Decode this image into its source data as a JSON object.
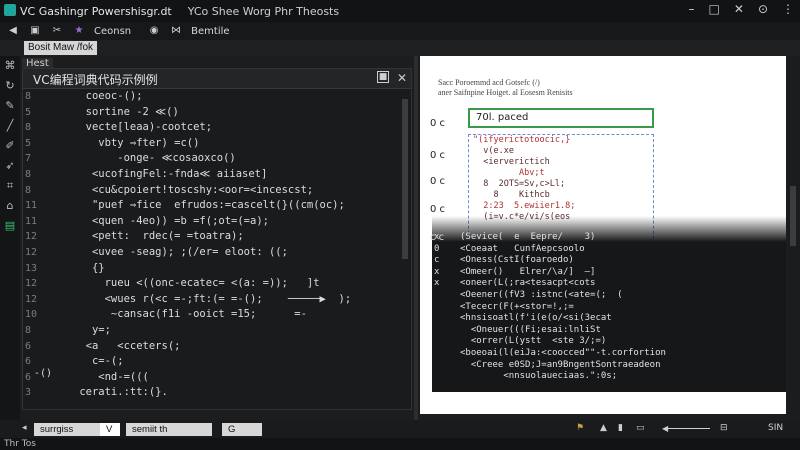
{
  "window": {
    "title": "VC Gashingr  Powershisgr.dt",
    "subtitle": "YCo Shee Worg Phr Theosts",
    "controls": [
      "–",
      "□",
      "✕",
      "⊙",
      "⋮"
    ]
  },
  "toolbar": {
    "label1": "Ceonsn",
    "label2": "Bemtile"
  },
  "menubar": {
    "pill": "Bosit Maw /fok"
  },
  "tree": {
    "label": "Hest"
  },
  "editor": {
    "tab_title": "VC编程词典代码示例例",
    "line_numbers": [
      "8",
      "5",
      "8",
      "5",
      "7",
      "8",
      "8",
      "11",
      "11",
      "12",
      "12",
      "13",
      "12",
      "12",
      "10",
      "8",
      "6",
      "6",
      "6",
      "3"
    ],
    "lines": [
      "  coeoc-();",
      "  sortine -2 ≪()",
      "  vecte[leaa)-cootcet;",
      "    vbty ⇒fter) =c()",
      "       -onge- ≪cosaoxco()",
      "   <ucofingFel:-fnda≪ aiiaset]",
      "   <cu&cpoiert!toscshy:<oor=<incescst;",
      "   \"puef ⇒fice  efrudos:=cascelt(}((cm(oc);",
      "   <quen -4eo)) =b =f(;ot=(=a);",
      "   <pett:  rdec(= =toatra);",
      "   <uvee -seag); ;(/er= eloot: ((;",
      "   {}",
      "     rueu <((onc-ecatec= <(a: =));   ]t",
      "     <wues r(<c =-;ft:(= =-();    ─────▶  );",
      "      ~cansac(f1i -ooict =15;      =-",
      "   y=;",
      "  <a   <cceters(;",
      "   c=-(;",
      "    <nd-=(((",
      " cerati.:tt:(}."
    ],
    "tail": "-()"
  },
  "right_pane": {
    "header_line1": "Sacc  Poroemmd acd Gotsefc (/)",
    "header_line2": "aner  Saifnpine Hoiget. al Eosesm Renisits",
    "row_labels": [
      "0 c",
      "0 c",
      "0 c",
      "0 c",
      "c  c"
    ],
    "input_value": "70l. paced",
    "box_lines": [
      "\"(ifyerictotoocic,}",
      "  v(e.xe",
      "  <ierverictich",
      "         Abv;t",
      "  8  2OTS=Sv,c>Ll;",
      "    8    Kithcb",
      "  2:23  5.ewiier1.8;",
      "  (i=v.c*e/vi/s(eos"
    ],
    "dark_gutter": [
      "x",
      "0",
      "",
      "c",
      "",
      "",
      "",
      "",
      "",
      "x",
      "x",
      ""
    ],
    "dark_lines": [
      "(Sevice(  e  Eepre/    3)",
      "<Coeaat   CunfAepcsoolo",
      "<Oness(CstI(foaroedo)",
      "<Omeer()   Elrer/\\a/]  —]",
      "<oneer(L(;ra<tesacpt<cots",
      "<Oeener((fV3 :istnc(<ate=(;  (",
      "<Tececr(F(+<stor=!,;=",
      "<hnsisoatl(f'i(e(o/<si(3ecat",
      "  <Oneuer(((Fi;esai:lnliSt",
      "  <orrer(L(ystt  <ste 3/;=)",
      "<boeoai(l(eiJa:<coocced\"\"-t.corfortion",
      "  <Creee e0SD;J=an9BngentSontraeadeon",
      "        <nnsuolaueciaas.\":0s;"
    ]
  },
  "bottom": {
    "tab1": "surrgiss",
    "tab1_suffix": "V",
    "tab2": "semiit  th",
    "tab3": "G",
    "status": "Thr Tos",
    "right_label": "SIN"
  }
}
